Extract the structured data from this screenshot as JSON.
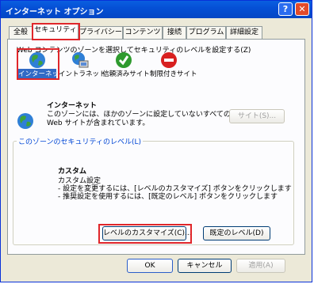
{
  "window": {
    "title": "インターネット オプション",
    "help_glyph": "?",
    "close_glyph": "✕"
  },
  "tabs": [
    {
      "label": "全般",
      "active": false
    },
    {
      "label": "セキュリティ",
      "active": true
    },
    {
      "label": "プライバシー",
      "active": false
    },
    {
      "label": "コンテンツ",
      "active": false
    },
    {
      "label": "接続",
      "active": false
    },
    {
      "label": "プログラム",
      "active": false
    },
    {
      "label": "詳細設定",
      "active": false
    }
  ],
  "security": {
    "instruction": "Web コンテンツのゾーンを選択してセキュリティのレベルを設定する(Z)",
    "zones": [
      {
        "label": "インターネット",
        "icon": "globe-icon",
        "selected": true
      },
      {
        "label": "イントラネット",
        "icon": "intranet-icon",
        "selected": false
      },
      {
        "label": "信頼済みサイト",
        "icon": "checkmark-icon",
        "selected": false
      },
      {
        "label": "制限付きサイト",
        "icon": "restricted-icon",
        "selected": false
      }
    ],
    "zone_info": {
      "title": "インターネット",
      "line1": "このゾーンには、ほかのゾーンに設定していないすべての",
      "line2": "Web サイトが含まれています。",
      "sites_button": "サイト(S)..."
    },
    "level_group": {
      "label": "このゾーンのセキュリティのレベル(L)",
      "level_title": "カスタム",
      "desc1": "カスタム設定",
      "desc2": "- 設定を変更するには、[レベルのカスタマイズ] ボタンをクリックします",
      "desc3": "- 推奨設定を使用するには、[既定のレベル] ボタンをクリックします",
      "customize_button": "レベルのカスタマイズ(C)...",
      "default_button": "既定のレベル(D)"
    }
  },
  "footer": {
    "ok": "OK",
    "cancel": "キャンセル",
    "apply": "適用(A)"
  },
  "colors": {
    "titlebar": "#0550d6",
    "highlight": "#e0262a",
    "selection": "#316ac5"
  }
}
